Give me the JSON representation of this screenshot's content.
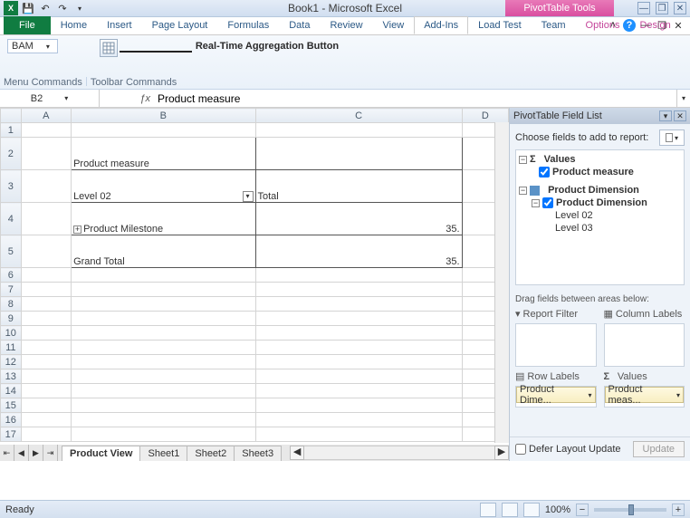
{
  "titlebar": {
    "title": "Book1 - Microsoft Excel"
  },
  "contextual_tab": "PivotTable Tools",
  "ribbon_tabs": [
    "File",
    "Home",
    "Insert",
    "Page Layout",
    "Formulas",
    "Data",
    "Review",
    "View",
    "Add-Ins",
    "Load Test",
    "Team",
    "Options",
    "Design"
  ],
  "active_tab_index": 8,
  "ribbon": {
    "bam_label": "BAM",
    "annotation": "Real-Time Aggregation Button",
    "group_labels": [
      "Menu Commands",
      "Toolbar Commands"
    ]
  },
  "namebox": "B2",
  "formula": "Product measure",
  "columns": [
    "A",
    "B",
    "C",
    "D"
  ],
  "rows_visible": 17,
  "pivot": {
    "pos": {
      "measure": "Product measure",
      "level_label": "Level 02",
      "total_header": "Total",
      "milestone_label": "Product Milestone",
      "milestone_value": "35.",
      "grand_total_label": "Grand Total",
      "grand_total_value": "35."
    }
  },
  "sheet_tabs": [
    "Product View",
    "Sheet1",
    "Sheet2",
    "Sheet3"
  ],
  "active_sheet": 0,
  "field_list": {
    "title": "PivotTable Field List",
    "choose_label": "Choose fields to add to report:",
    "tree": {
      "values_group": "Values",
      "product_measure": "Product measure",
      "dimension_group": "Product Dimension",
      "dimension_item": "Product Dimension",
      "level02": "Level 02",
      "level03": "Level 03"
    },
    "areas_label": "Drag fields between areas below:",
    "area_names": {
      "filter": "Report Filter",
      "columns": "Column Labels",
      "rows": "Row Labels",
      "values": "Values"
    },
    "row_pill": "Product Dime...",
    "value_pill": "Product meas...",
    "defer": "Defer Layout Update",
    "update": "Update"
  },
  "status": {
    "ready": "Ready",
    "zoom": "100%"
  }
}
